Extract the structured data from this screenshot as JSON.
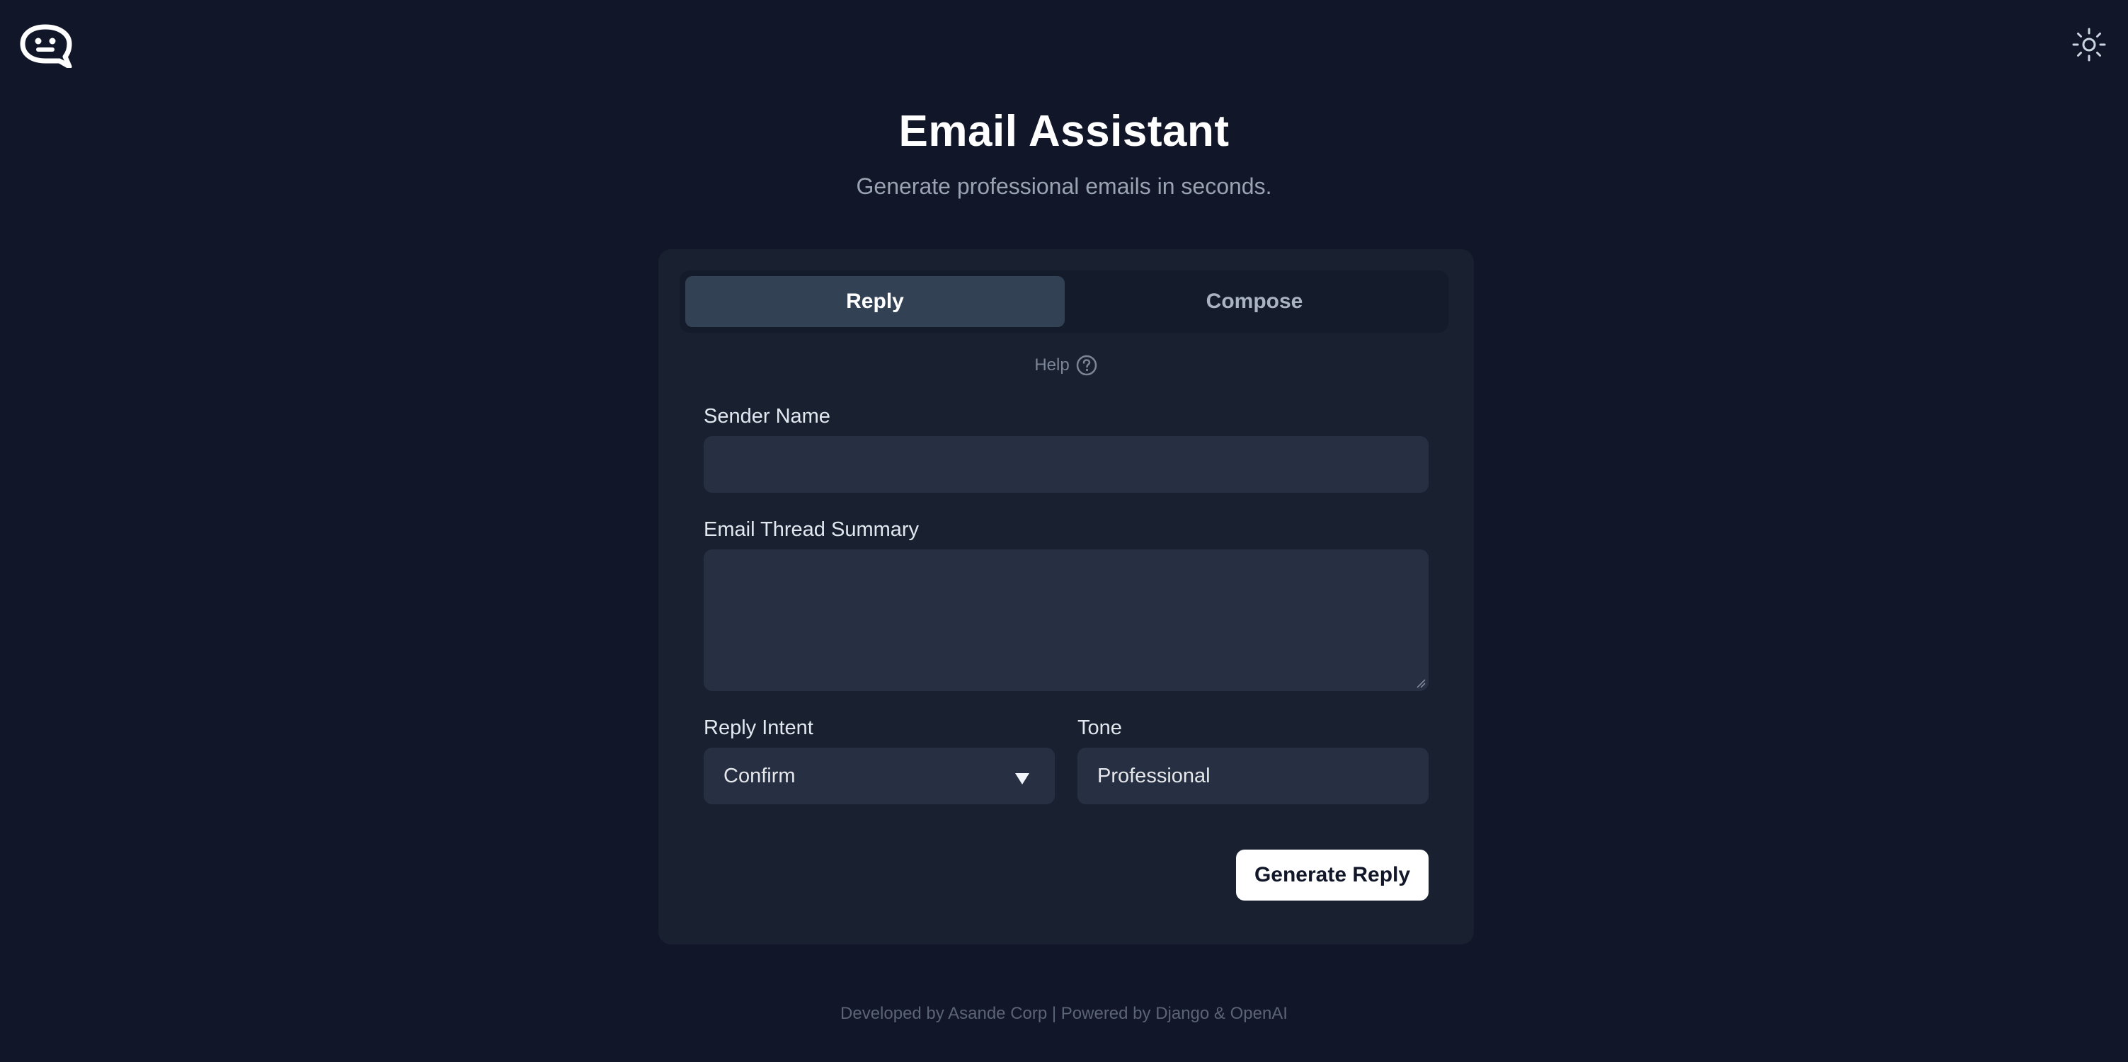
{
  "app": {
    "logo_icon": "chat-bubble-face-icon",
    "theme_toggle_icon": "sun-icon"
  },
  "header": {
    "title": "Email Assistant",
    "subtitle": "Generate professional emails in seconds."
  },
  "tabs": [
    {
      "label": "Reply",
      "active": true
    },
    {
      "label": "Compose",
      "active": false
    }
  ],
  "help": {
    "label": "Help",
    "icon": "question-circle-icon"
  },
  "form": {
    "sender_name": {
      "label": "Sender Name",
      "value": ""
    },
    "thread_summary": {
      "label": "Email Thread Summary",
      "value": ""
    },
    "reply_intent": {
      "label": "Reply Intent",
      "selected": "Confirm"
    },
    "tone": {
      "label": "Tone",
      "value": "Professional"
    },
    "submit_label": "Generate Reply"
  },
  "footer": {
    "text": "Developed by Asande Corp | Powered by Django & OpenAI"
  },
  "colors": {
    "background": "#111729",
    "card": "#19202f",
    "active_tab": "#334155",
    "input": "#273043",
    "button": "#ffffff"
  }
}
